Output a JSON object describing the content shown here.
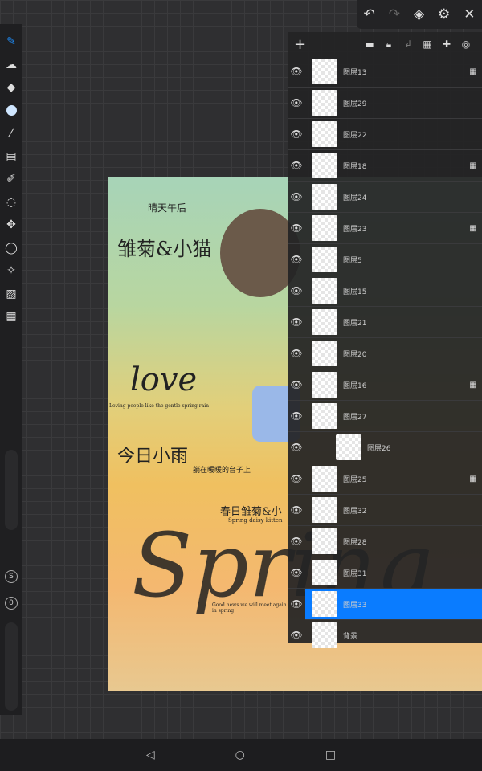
{
  "top_toolbar": {
    "undo": "↶",
    "redo": "↷",
    "layers": "◈",
    "settings": "⚙",
    "close": "✕"
  },
  "left_toolbar": [
    "brush",
    "smudge",
    "eraser",
    "color",
    "eyedropper",
    "filter",
    "brush-settings",
    "lasso-fill",
    "transform",
    "selection",
    "magic-wand",
    "canvas-image",
    "grid"
  ],
  "left_buttons": {
    "s": "S",
    "zero": "0"
  },
  "layer_panel": {
    "add": "+",
    "actions": [
      "folder-icon",
      "lock-icon",
      "clip-icon",
      "alpha-lock-icon",
      "pin-icon",
      "blend-icon"
    ],
    "layers": [
      {
        "name": "图层13",
        "alpha_lock": true
      },
      {
        "name": "图层29",
        "alpha_lock": false
      },
      {
        "name": "图层22",
        "alpha_lock": false
      },
      {
        "name": "图层18",
        "alpha_lock": true
      },
      {
        "name": "图层24",
        "alpha_lock": false
      },
      {
        "name": "图层23",
        "alpha_lock": true
      },
      {
        "name": "图层5",
        "alpha_lock": false
      },
      {
        "name": "图层15",
        "alpha_lock": false
      },
      {
        "name": "图层21",
        "alpha_lock": false
      },
      {
        "name": "图层20",
        "alpha_lock": false
      },
      {
        "name": "图层16",
        "alpha_lock": true
      },
      {
        "name": "图层27",
        "alpha_lock": false
      },
      {
        "name": "图层26",
        "alpha_lock": false,
        "clipped": true
      },
      {
        "name": "图层25",
        "alpha_lock": true
      },
      {
        "name": "图层32",
        "alpha_lock": false
      },
      {
        "name": "图层28",
        "alpha_lock": false
      },
      {
        "name": "图层31",
        "alpha_lock": false
      },
      {
        "name": "图层33",
        "alpha_lock": false,
        "selected": true
      },
      {
        "name": "背景",
        "alpha_lock": false
      }
    ]
  },
  "artwork": {
    "t1": "晴天午后",
    "t2": "雏菊&小猫",
    "t3": "love",
    "t4": "Loving people like the gentle spring rain",
    "t5": "今日小雨",
    "t6": "躺在暖暖的台子上",
    "t7": "春日雏菊&小",
    "t8": "Spring daisy kitten",
    "t9": "Spring",
    "t10": "Good news we will meet again in spring"
  },
  "nav": {
    "back": "◁",
    "home": "○",
    "recent": "□"
  }
}
